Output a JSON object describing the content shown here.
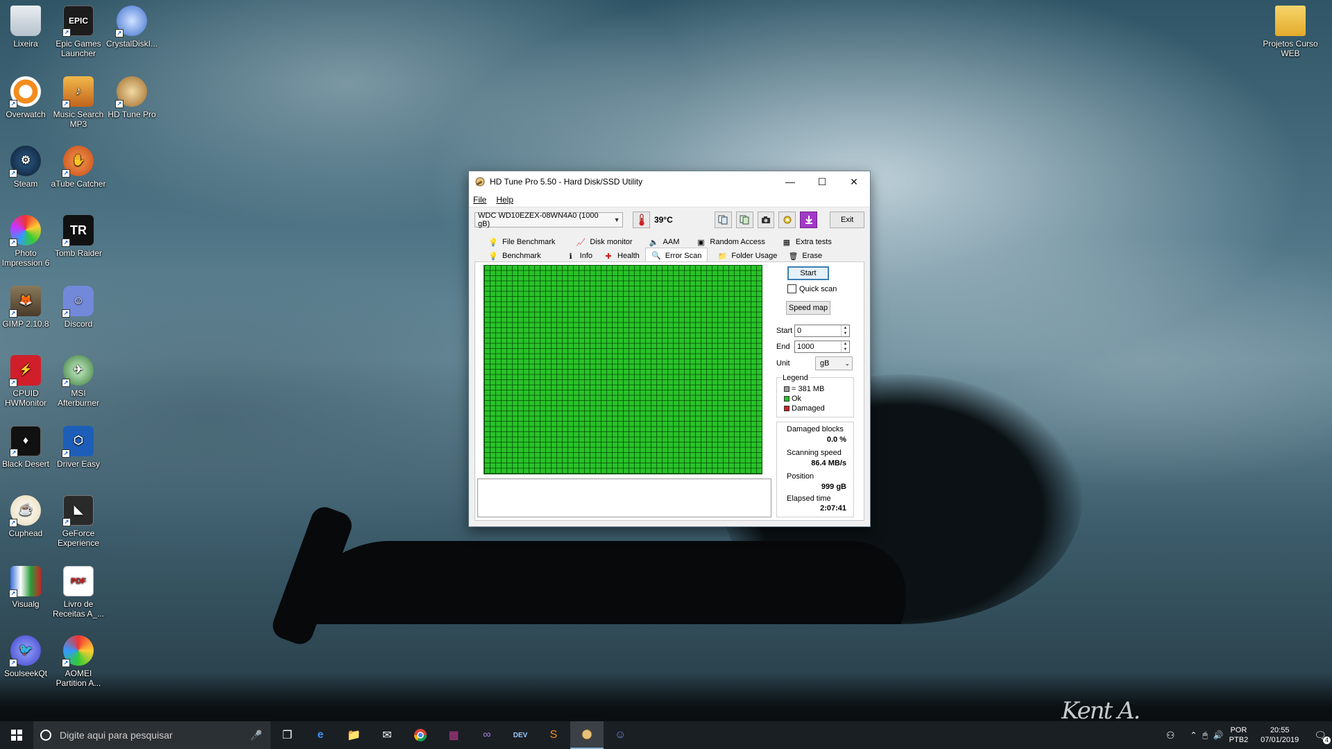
{
  "desktop": {
    "icons": [
      {
        "label": "Lixeira"
      },
      {
        "label": "Epic Games Launcher"
      },
      {
        "label": "CrystalDiskI..."
      },
      {
        "label": "Overwatch"
      },
      {
        "label": "Music Search MP3"
      },
      {
        "label": "HD Tune Pro"
      },
      {
        "label": "Steam"
      },
      {
        "label": "aTube Catcher"
      },
      {
        "label": "Photo Impression 6"
      },
      {
        "label": "Tomb Raider"
      },
      {
        "label": "GIMP 2.10.8"
      },
      {
        "label": "Discord"
      },
      {
        "label": "CPUID HWMonitor"
      },
      {
        "label": "MSI Afterburner"
      },
      {
        "label": "Black Desert"
      },
      {
        "label": "Driver Easy"
      },
      {
        "label": "Cuphead"
      },
      {
        "label": "GeForce Experience"
      },
      {
        "label": "Visualg"
      },
      {
        "label": "Livro de Receitas A_..."
      },
      {
        "label": "SoulseekQt"
      },
      {
        "label": "AOMEI Partition A..."
      },
      {
        "label": "Projetos Curso WEB"
      }
    ]
  },
  "window": {
    "title": "HD Tune Pro 5.50 - Hard Disk/SSD Utility",
    "menu": {
      "file": "File",
      "help": "Help"
    },
    "drive": "WDC WD10EZEX-08WN4A0 (1000 gB)",
    "temperature": "39°C",
    "exit_label": "Exit",
    "tabs_top": [
      "File Benchmark",
      "Disk monitor",
      "AAM",
      "Random Access",
      "Extra tests"
    ],
    "tabs_bottom": [
      "Benchmark",
      "Info",
      "Health",
      "Error Scan",
      "Folder Usage",
      "Erase"
    ],
    "active_tab": "Error Scan",
    "side": {
      "start_button": "Start",
      "quick_scan": "Quick scan",
      "quick_scan_checked": false,
      "speed_map": "Speed map",
      "start_label": "Start",
      "start_value": "0",
      "end_label": "End",
      "end_value": "1000",
      "unit_label": "Unit",
      "unit_value": "gB",
      "legend_title": "Legend",
      "legend": [
        {
          "label": "= 381 MB",
          "color": "#9a9a9a"
        },
        {
          "label": "Ok",
          "color": "#29c229"
        },
        {
          "label": "Damaged",
          "color": "#d21f1f"
        }
      ],
      "stats": {
        "damaged_label": "Damaged blocks",
        "damaged_value": "0.0 %",
        "speed_label": "Scanning speed",
        "speed_value": "86.4 MB/s",
        "position_label": "Position",
        "position_value": "999 gB",
        "elapsed_label": "Elapsed time",
        "elapsed_value": "2:07:41"
      }
    },
    "scan_color": "#29c229"
  },
  "taskbar": {
    "search_placeholder": "Digite aqui para pesquisar",
    "ime_line1": "POR",
    "ime_line2": "PTB2",
    "time": "20:55",
    "date": "07/01/2019",
    "notifications": "4"
  }
}
